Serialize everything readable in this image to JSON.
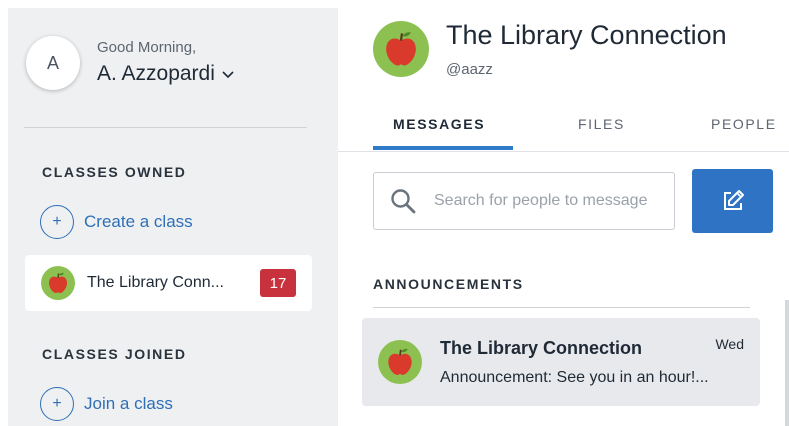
{
  "user": {
    "avatar_letter": "A",
    "greeting": "Good Morning,",
    "name": "A. Azzopardi"
  },
  "sidebar": {
    "classes_owned_label": "CLASSES OWNED",
    "create_class_label": "Create a class",
    "owned_classes": [
      {
        "name": "The Library Conn...",
        "unread_count": "17",
        "icon": "apple-icon"
      }
    ],
    "classes_joined_label": "CLASSES JOINED",
    "join_class_label": "Join a class"
  },
  "header": {
    "title": "The Library Connection",
    "handle": "@aazz",
    "icon": "apple-icon"
  },
  "tabs": [
    {
      "label": "MESSAGES",
      "active": true
    },
    {
      "label": "FILES",
      "active": false
    },
    {
      "label": "PEOPLE",
      "active": false
    }
  ],
  "search": {
    "placeholder": "Search for people to message",
    "value": ""
  },
  "compose": {
    "icon": "compose-icon"
  },
  "announcements": {
    "label": "ANNOUNCEMENTS",
    "items": [
      {
        "title": "The Library Connection",
        "day": "Wed",
        "preview": "Announcement: See you in an hour!..."
      }
    ]
  },
  "colors": {
    "accent": "#2f74c4",
    "badge": "#c8323c",
    "sidebar_bg": "#eef0f2",
    "apple_green": "#8cc152",
    "apple_red": "#d93a2b"
  }
}
